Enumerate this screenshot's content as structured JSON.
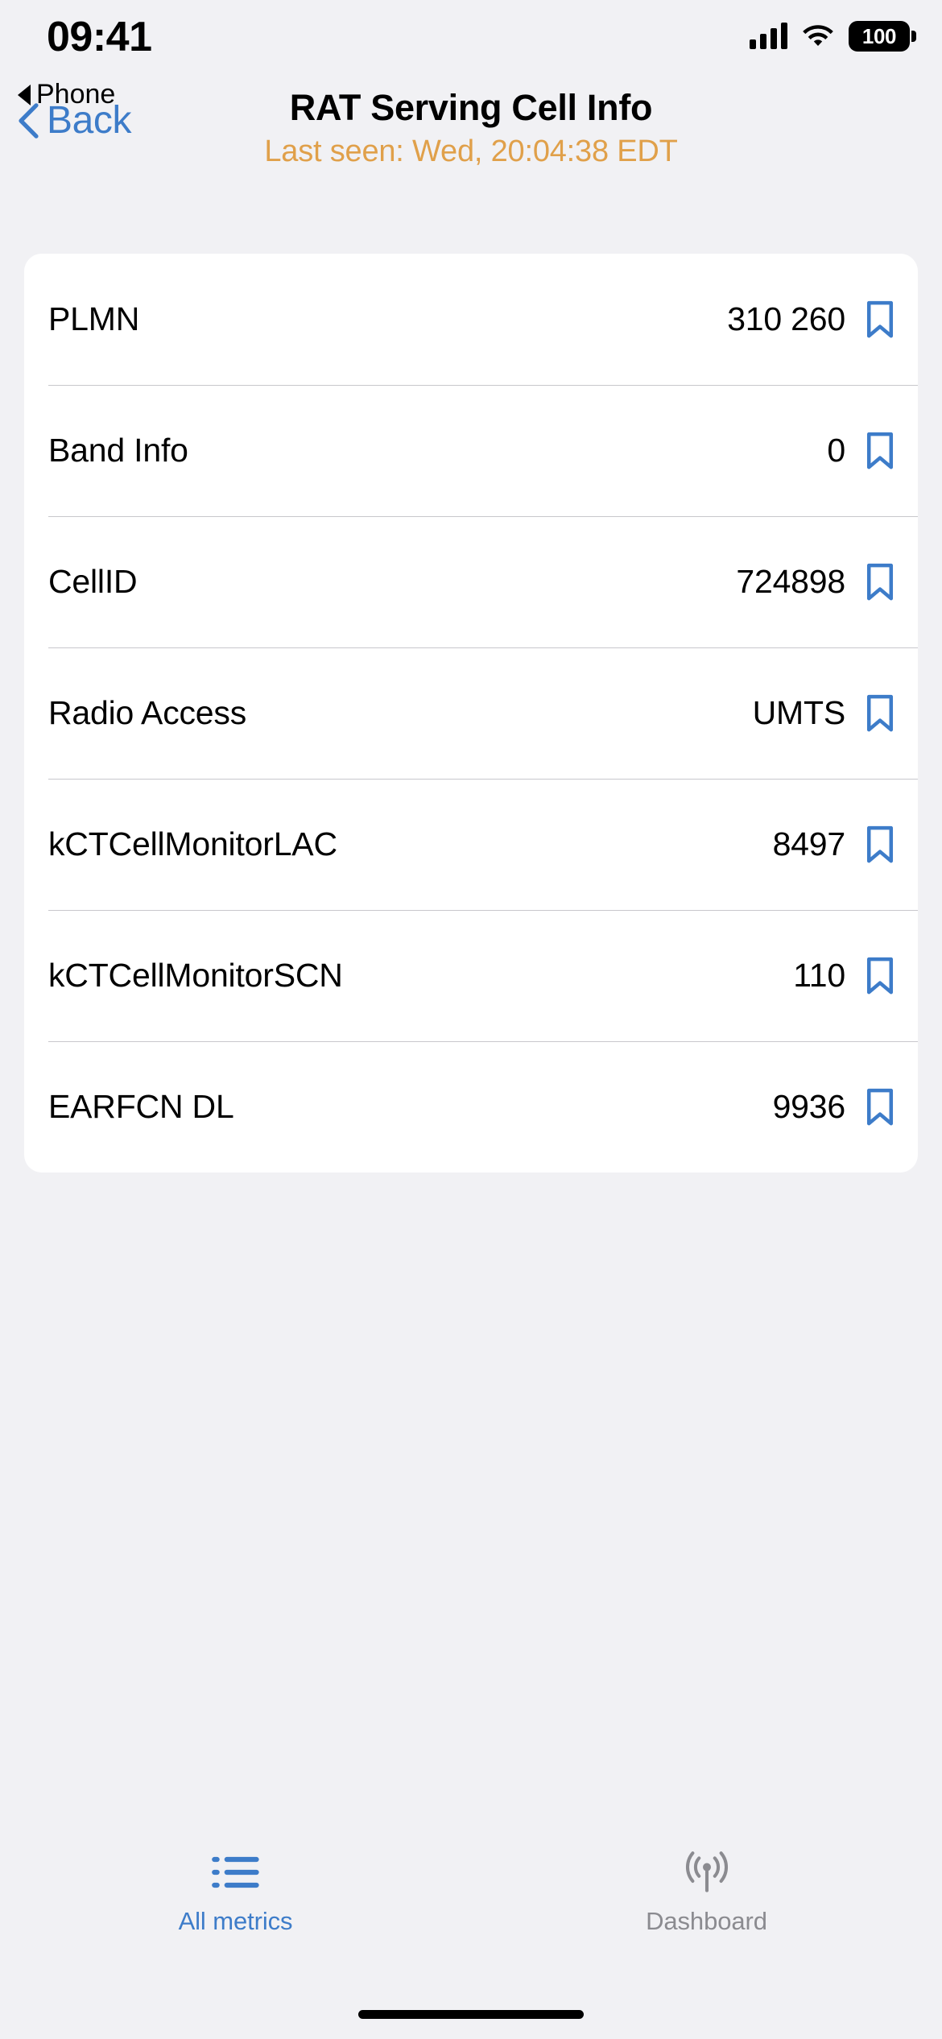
{
  "status_bar": {
    "time": "09:41",
    "battery_level": "100",
    "signal_icon": "cellular-signal-icon",
    "wifi_icon": "wifi-icon",
    "battery_icon": "battery-icon"
  },
  "breadcrumb": {
    "label": "Phone",
    "icon": "back-triangle-icon"
  },
  "navbar": {
    "back_label": "Back",
    "back_icon": "chevron-left-icon",
    "title": "RAT Serving Cell Info",
    "subtitle": "Last seen: Wed, 20:04:38 EDT",
    "subtitle_color": "#e0a04a",
    "accent_color": "#3d7cc9"
  },
  "metrics": {
    "rows": [
      {
        "label": "PLMN",
        "value": "310 260",
        "bookmark_icon": "bookmark-icon"
      },
      {
        "label": "Band Info",
        "value": "0",
        "bookmark_icon": "bookmark-icon"
      },
      {
        "label": "CellID",
        "value": "724898",
        "bookmark_icon": "bookmark-icon"
      },
      {
        "label": "Radio Access",
        "value": "UMTS",
        "bookmark_icon": "bookmark-icon"
      },
      {
        "label": "kCTCellMonitorLAC",
        "value": "8497",
        "bookmark_icon": "bookmark-icon"
      },
      {
        "label": "kCTCellMonitorSCN",
        "value": "110",
        "bookmark_icon": "bookmark-icon"
      },
      {
        "label": "EARFCN DL",
        "value": "9936",
        "bookmark_icon": "bookmark-icon"
      }
    ]
  },
  "tabbar": {
    "tabs": [
      {
        "label": "All metrics",
        "icon": "list-bullet-icon",
        "active": true,
        "color": "#3d7cc9"
      },
      {
        "label": "Dashboard",
        "icon": "broadcast-antenna-icon",
        "active": false,
        "color": "#8b8b90"
      }
    ]
  }
}
